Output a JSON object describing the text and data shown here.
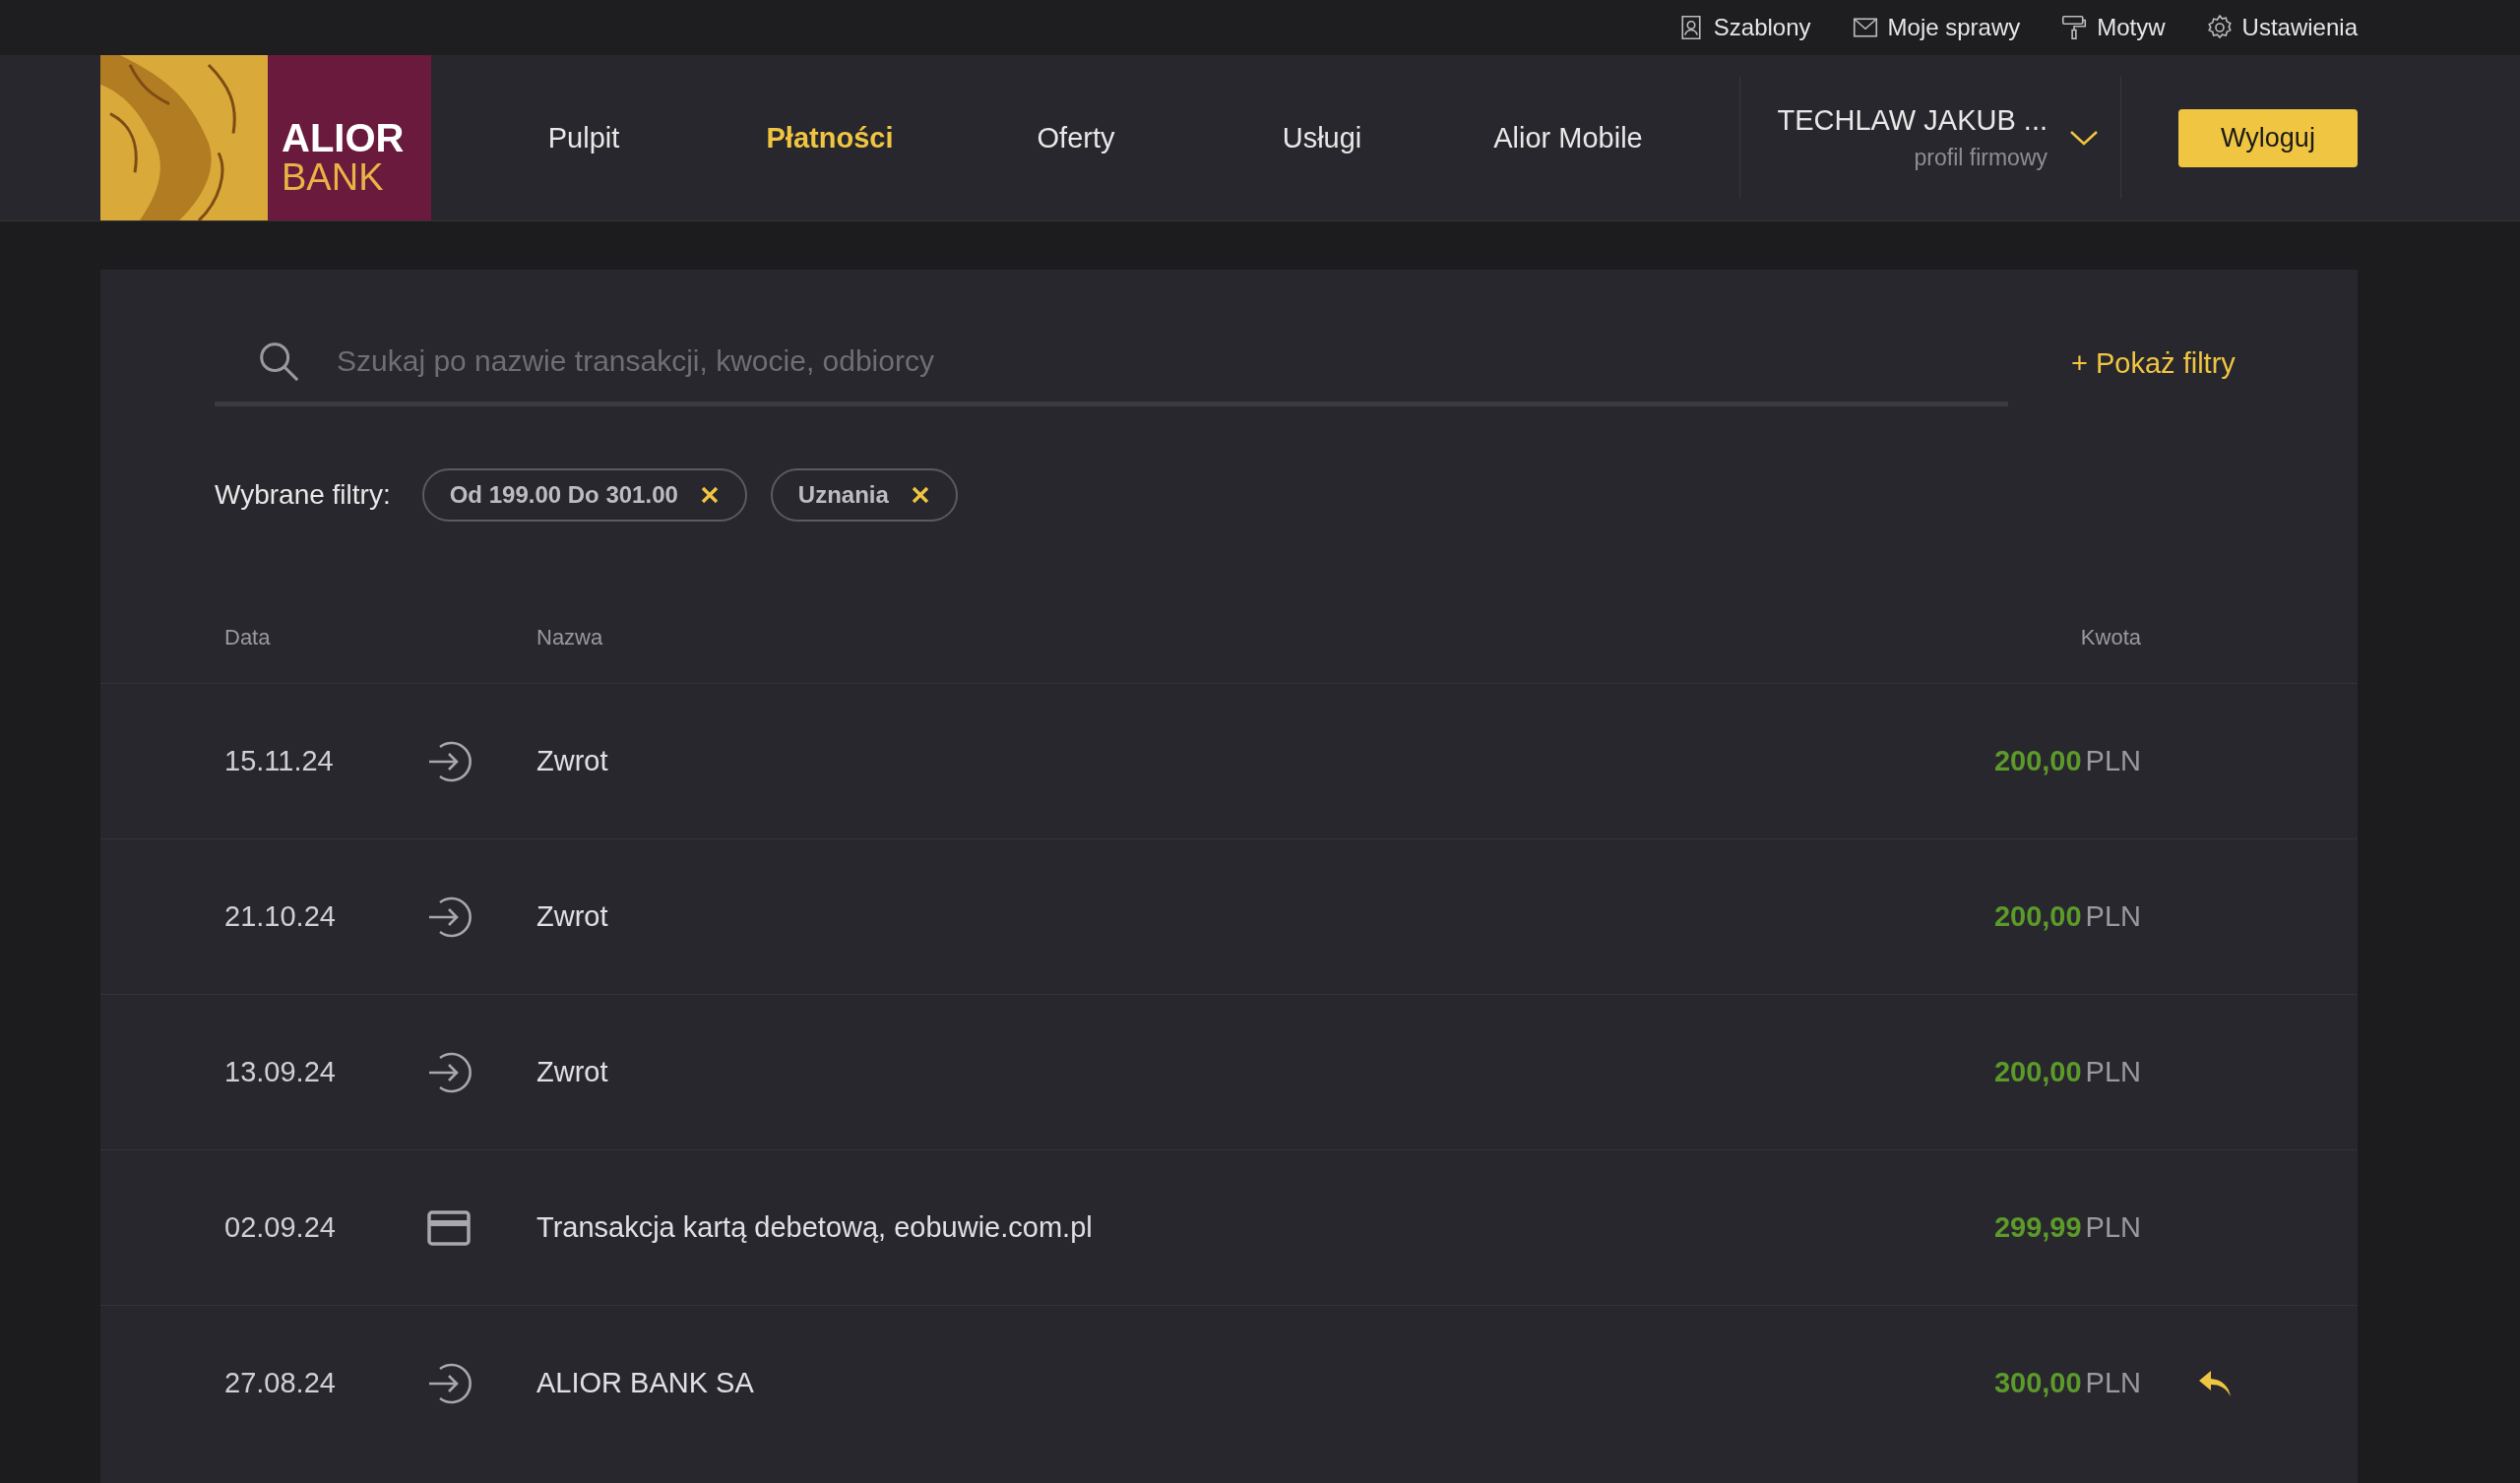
{
  "top_links": [
    {
      "kind": "templates",
      "label": "Szablony"
    },
    {
      "kind": "messages",
      "label": "Moje sprawy"
    },
    {
      "kind": "theme",
      "label": "Motyw"
    },
    {
      "kind": "settings",
      "label": "Ustawienia"
    }
  ],
  "logo": {
    "line1": "ALIOR",
    "line2": "BANK"
  },
  "nav": [
    {
      "label": "Pulpit",
      "selected": false
    },
    {
      "label": "Płatności",
      "selected": true
    },
    {
      "label": "Oferty",
      "selected": false
    },
    {
      "label": "Usługi",
      "selected": false
    },
    {
      "label": "Alior Mobile",
      "selected": false
    }
  ],
  "profile": {
    "name": "TECHLAW JAKUB ...",
    "type": "profil firmowy"
  },
  "logout_button": "Wyloguj",
  "search": {
    "placeholder": "Szukaj po nazwie transakcji, kwocie, odbiorcy",
    "show_filters": "+ Pokaż filtry"
  },
  "filters": {
    "label": "Wybrane filtry:",
    "chips": [
      "Od 199.00 Do 301.00",
      "Uznania"
    ]
  },
  "table": {
    "columns": [
      "Data",
      "Nazwa",
      "Kwota"
    ],
    "rows": [
      {
        "date": "15.11.24",
        "kind": "incoming",
        "name": "Zwrot",
        "amount": "200,00",
        "currency": "PLN",
        "reply": false
      },
      {
        "date": "21.10.24",
        "kind": "incoming",
        "name": "Zwrot",
        "amount": "200,00",
        "currency": "PLN",
        "reply": false
      },
      {
        "date": "13.09.24",
        "kind": "incoming",
        "name": "Zwrot",
        "amount": "200,00",
        "currency": "PLN",
        "reply": false
      },
      {
        "date": "02.09.24",
        "kind": "card",
        "name": "Transakcja kartą debetową, eobuwie.com.pl",
        "amount": "299,99",
        "currency": "PLN",
        "reply": false
      },
      {
        "date": "27.08.24",
        "kind": "incoming",
        "name": "ALIOR BANK SA",
        "amount": "300,00",
        "currency": "PLN",
        "reply": true
      }
    ]
  }
}
